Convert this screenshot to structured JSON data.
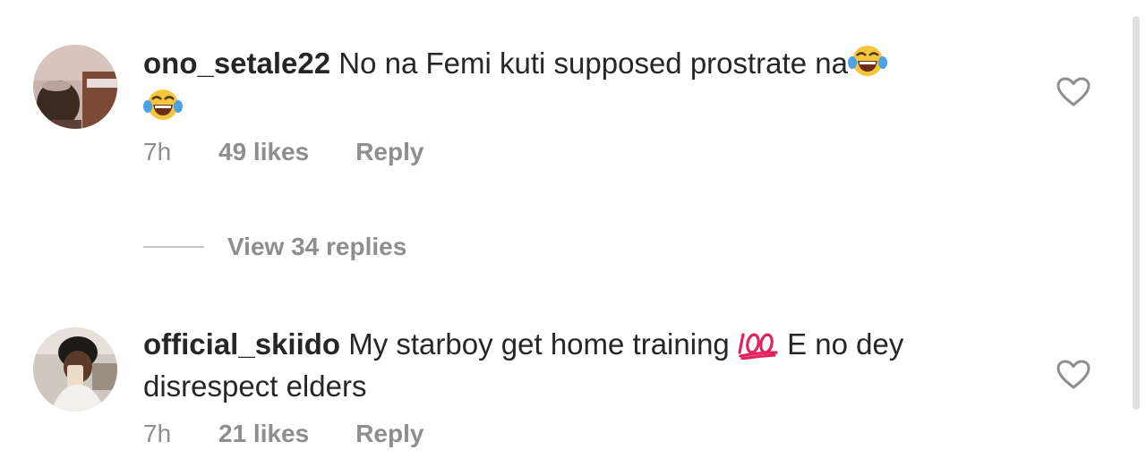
{
  "comments": [
    {
      "username": "ono_setale22",
      "text": "No na Femi kuti supposed prostrate na",
      "emojis": [
        "face-with-tears-of-joy",
        "face-with-tears-of-joy"
      ],
      "time": "7h",
      "likes": "49 likes",
      "reply": "Reply",
      "view_replies": "View 34 replies"
    },
    {
      "username": "official_skiido",
      "text_before": "My starboy get home training",
      "emoji": "hundred-points",
      "text_after": "E no dey disrespect elders",
      "time": "7h",
      "likes": "21 likes",
      "reply": "Reply"
    }
  ],
  "colors": {
    "text": "#262626",
    "secondary": "#8e8e8e",
    "divider": "#c7c7c7",
    "heart_outline": "#8e8e8e",
    "hundred_red": "#e0245e"
  }
}
